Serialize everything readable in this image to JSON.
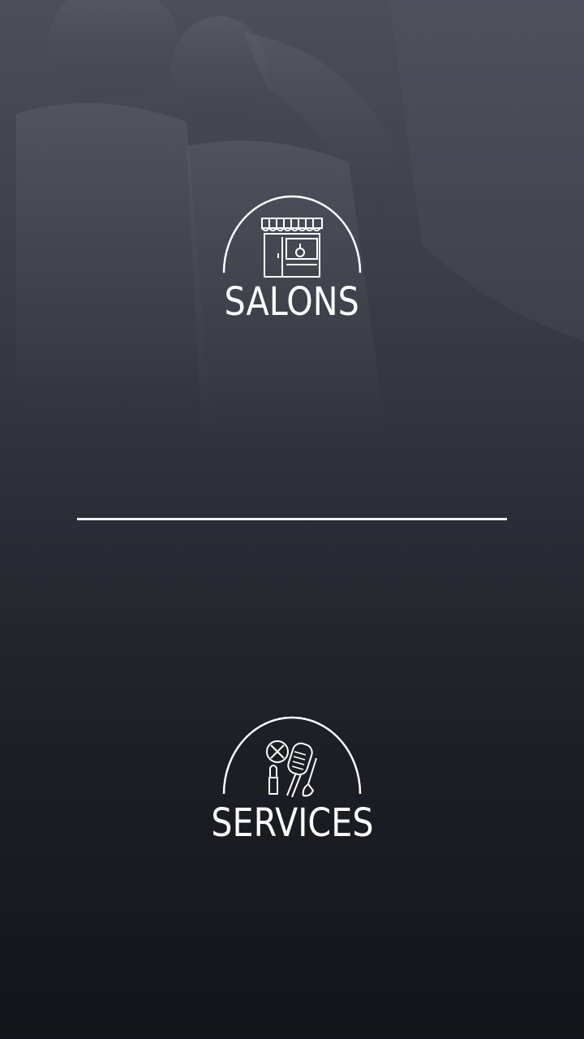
{
  "options": {
    "salons": {
      "label": "SALONS",
      "icon": "storefront-icon"
    },
    "services": {
      "label": "SERVICES",
      "icon": "beauty-tools-icon"
    }
  },
  "colors": {
    "background_top": "#4c4f5a",
    "background_bottom": "#13151a",
    "foreground": "#ffffff"
  }
}
